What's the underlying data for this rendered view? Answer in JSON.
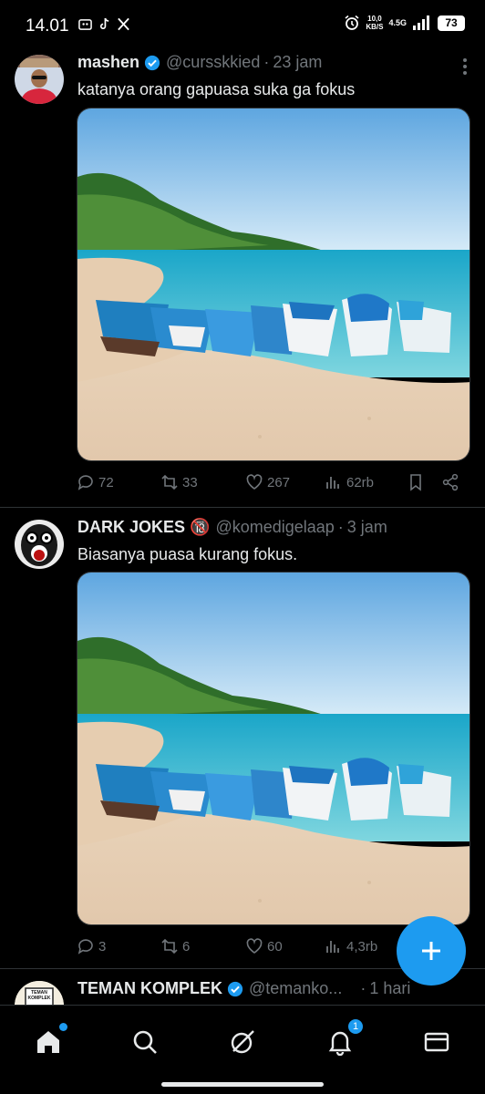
{
  "status_bar": {
    "time": "14.01",
    "net_speed_value": "10,0",
    "net_speed_unit": "KB/S",
    "net_type": "4.5G",
    "battery": "73"
  },
  "tweets": [
    {
      "name": "mashen",
      "verified": true,
      "handle": "@cursskkied",
      "age": "23 jam",
      "text": "katanya orang gapuasa suka ga fokus",
      "replies": "72",
      "reposts": "33",
      "likes": "267",
      "views": "62rb"
    },
    {
      "name": "DARK JOKES 🔞",
      "verified": false,
      "handle": "@komedigelaap",
      "age": "3 jam",
      "text": "Biasanya puasa kurang fokus.",
      "replies": "3",
      "reposts": "6",
      "likes": "60",
      "views": "4,3rb"
    },
    {
      "name": "TEMAN KOMPLEK",
      "verified": true,
      "handle": "@temanko...",
      "age": "1 hari",
      "avatar_text": "TEMAN KOMPLEK"
    }
  ],
  "nav": {
    "notifications_badge": "1"
  },
  "colors": {
    "accent": "#1d9bf0",
    "muted": "#71767b",
    "background": "#000000"
  },
  "icons": [
    "reply-icon",
    "repost-icon",
    "like-icon",
    "views-icon",
    "bookmark-icon",
    "share-icon",
    "home-icon",
    "search-icon",
    "grok-icon",
    "notifications-icon",
    "messages-icon",
    "compose-icon"
  ]
}
